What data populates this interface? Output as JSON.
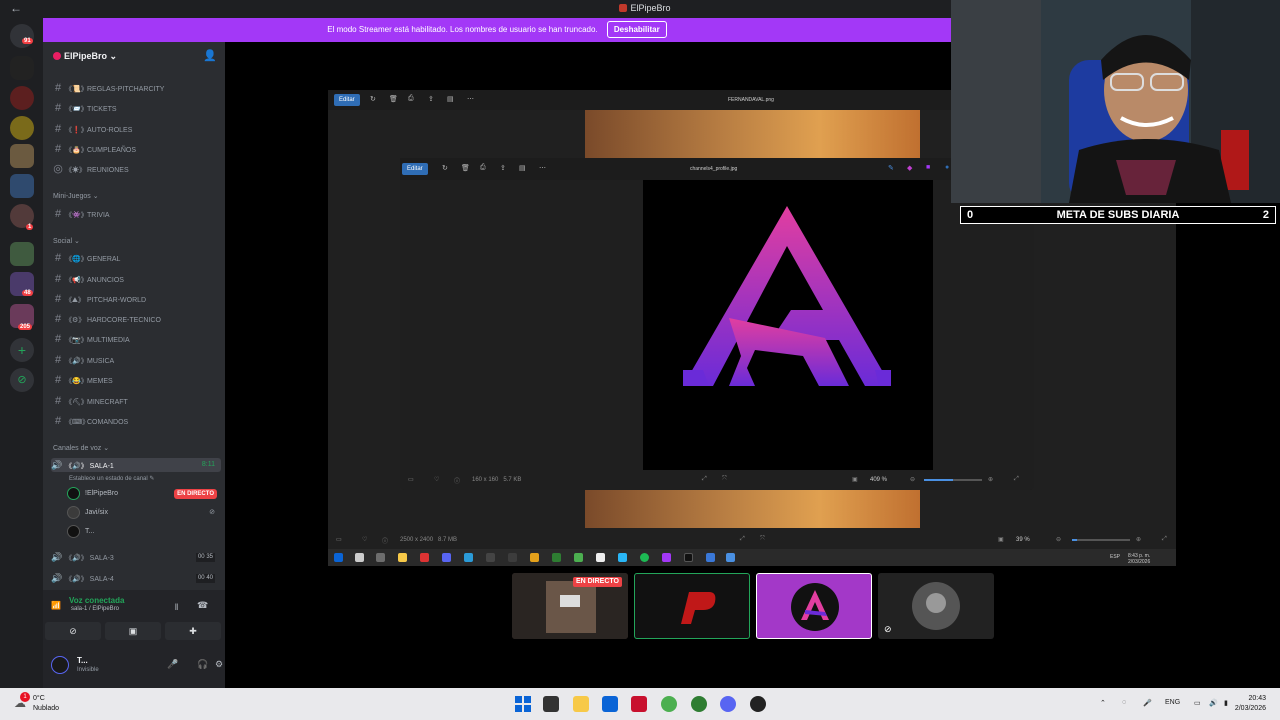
{
  "window": {
    "title": "ElPipeBro"
  },
  "banner": {
    "text": "El modo Streamer está habilitado. Los nombres de usuario se han truncado.",
    "button": "Deshabilitar"
  },
  "rail": {
    "badges": [
      "91",
      "1",
      "48",
      "205"
    ]
  },
  "server": {
    "name": "ElPipeBro"
  },
  "channels_top": [
    {
      "name": "REGLAS-PITCHARCITY"
    },
    {
      "name": "TICKETS"
    },
    {
      "name": "AUTO-ROLES"
    },
    {
      "name": "CUMPLEAÑOS"
    },
    {
      "name": "REUNIONES"
    }
  ],
  "categories": {
    "minijuegos": "Mini-Juegos",
    "social": "Social",
    "voz": "Canales de voz"
  },
  "channels_mini": [
    {
      "name": "TRIVIA"
    }
  ],
  "channels_social": [
    {
      "name": "GENERAL"
    },
    {
      "name": "ANUNCIOS"
    },
    {
      "name": "PITCHAR-WORLD"
    },
    {
      "name": "HARDCORE-TECNICO"
    },
    {
      "name": "MULTIMEDIA"
    },
    {
      "name": "MUSICA"
    },
    {
      "name": "MEMES"
    },
    {
      "name": "MINECRAFT"
    },
    {
      "name": "COMANDOS"
    }
  ],
  "voice": {
    "active": {
      "name": "SALA-1",
      "time": "8:11",
      "status": "Establece un estado de canal"
    },
    "members": [
      {
        "name": "!ElPipeBro",
        "tag": "EN DIRECTO"
      },
      {
        "name": "Javi/six"
      },
      {
        "name": "T..."
      }
    ],
    "others": [
      {
        "name": "SALA-3",
        "count_a": "00",
        "count_b": "35"
      },
      {
        "name": "SALA-4",
        "count_a": "00",
        "count_b": "40"
      }
    ]
  },
  "voice_panel": {
    "connected": "Voz conectada",
    "sub": "sala-1 / ElPipeBro"
  },
  "user": {
    "name": "T...",
    "status": "Invisible"
  },
  "shared": {
    "edit_label": "Editar",
    "outer_file": "FERNANDAVAL.png",
    "inner_file": "channels4_profile.jpg",
    "inner_size": "160 x 160",
    "inner_weight": "5.7 KB",
    "inner_zoom": "409 %",
    "outer_size": "2500 x 2400",
    "outer_weight": "8.7 MB",
    "outer_zoom": "39 %",
    "clock": "8:43 p. m.",
    "date": "2/03/2026",
    "lang": "ESP"
  },
  "goal": {
    "left": "0",
    "label": "META DE SUBS DIARIA",
    "right": "2"
  },
  "tiles": {
    "live": "EN DIRECTO"
  },
  "taskbar": {
    "temp": "0°C",
    "weather": "Nublado",
    "lang": "ENG",
    "time": "20:43",
    "date": "2/03/2026",
    "alert": "1"
  },
  "colors": {
    "accent": "#a338f7",
    "live": "#ed4245",
    "connected": "#23a55a",
    "logo_top": "#e23ea0",
    "logo_bottom": "#6a2bd8"
  }
}
